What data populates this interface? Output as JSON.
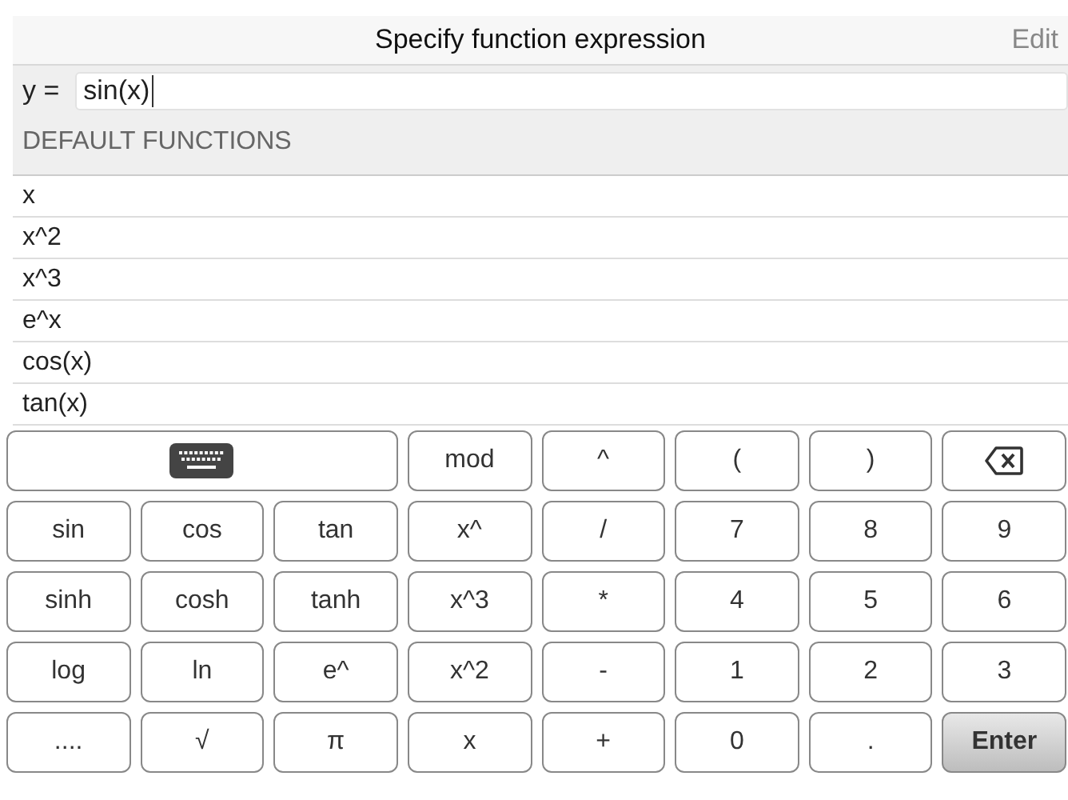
{
  "header": {
    "title": "Specify function expression",
    "action": "Edit"
  },
  "input": {
    "label": "y =",
    "value": "sin(x)"
  },
  "section": {
    "title": "DEFAULT FUNCTIONS"
  },
  "functions": [
    "x",
    "x^2",
    "x^3",
    "e^x",
    "cos(x)",
    "tan(x)"
  ],
  "keypad": [
    [
      {
        "kind": "keyboard"
      },
      {
        "kind": "key",
        "label": "mod"
      },
      {
        "kind": "key",
        "label": "^"
      },
      {
        "kind": "key",
        "label": "("
      },
      {
        "kind": "key",
        "label": ")"
      },
      {
        "kind": "backspace"
      }
    ],
    [
      {
        "kind": "key",
        "label": "sin"
      },
      {
        "kind": "key",
        "label": "cos"
      },
      {
        "kind": "key",
        "label": "tan"
      },
      {
        "kind": "key",
        "label": "x^"
      },
      {
        "kind": "key",
        "label": "/"
      },
      {
        "kind": "key",
        "label": "7"
      },
      {
        "kind": "key",
        "label": "8"
      },
      {
        "kind": "key",
        "label": "9"
      }
    ],
    [
      {
        "kind": "key",
        "label": "sinh"
      },
      {
        "kind": "key",
        "label": "cosh"
      },
      {
        "kind": "key",
        "label": "tanh"
      },
      {
        "kind": "key",
        "label": "x^3"
      },
      {
        "kind": "key",
        "label": "*"
      },
      {
        "kind": "key",
        "label": "4"
      },
      {
        "kind": "key",
        "label": "5"
      },
      {
        "kind": "key",
        "label": "6"
      }
    ],
    [
      {
        "kind": "key",
        "label": "log"
      },
      {
        "kind": "key",
        "label": "ln"
      },
      {
        "kind": "key",
        "label": "e^"
      },
      {
        "kind": "key",
        "label": "x^2"
      },
      {
        "kind": "key",
        "label": "-"
      },
      {
        "kind": "key",
        "label": "1"
      },
      {
        "kind": "key",
        "label": "2"
      },
      {
        "kind": "key",
        "label": "3"
      }
    ],
    [
      {
        "kind": "key",
        "label": "...."
      },
      {
        "kind": "key",
        "label": "√"
      },
      {
        "kind": "key",
        "label": "π"
      },
      {
        "kind": "key",
        "label": "x"
      },
      {
        "kind": "key",
        "label": "+"
      },
      {
        "kind": "key",
        "label": "0"
      },
      {
        "kind": "key",
        "label": "."
      },
      {
        "kind": "enter",
        "label": "Enter"
      }
    ]
  ]
}
